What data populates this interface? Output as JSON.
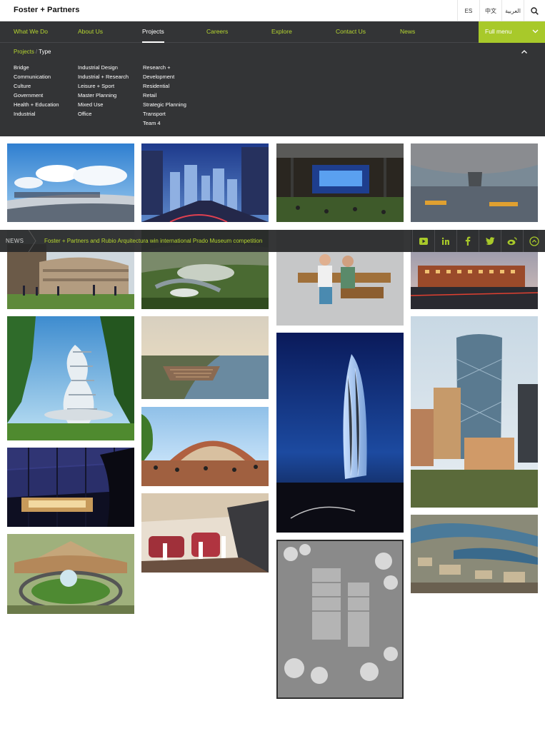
{
  "header": {
    "logo": "Foster + Partners",
    "languages": [
      "ES",
      "中文",
      "العربية"
    ]
  },
  "nav": {
    "items": [
      "What We Do",
      "About Us",
      "Projects",
      "Careers",
      "Explore",
      "Contact Us",
      "News"
    ],
    "active": "Projects",
    "full_menu": "Full menu"
  },
  "mega": {
    "breadcrumb_root": "Projects",
    "breadcrumb_sep": "/",
    "breadcrumb_current": "Type",
    "columns": [
      [
        "Bridge",
        "Communication",
        "Culture",
        "Government",
        "Health + Education",
        "Industrial"
      ],
      [
        "Industrial Design",
        "Industrial + Research",
        "Leisure + Sport",
        "Master Planning",
        "Mixed Use",
        "Office"
      ],
      [
        "Research +",
        "Development",
        "Residential",
        "Retail",
        "Strategic Planning",
        "Transport",
        "Team 4"
      ]
    ]
  },
  "news": {
    "label": "NEWS",
    "headline": "Foster + Partners and Rubio Arquitectura win international Prado Museum competition",
    "social": [
      "youtube-icon",
      "linkedin-icon",
      "facebook-icon",
      "twitter-icon",
      "weibo-icon",
      "scroll-up-icon"
    ]
  },
  "colors": {
    "accent": "#b6d630",
    "nav_bg": "#333436",
    "full_menu_bg": "#a8c92a"
  }
}
